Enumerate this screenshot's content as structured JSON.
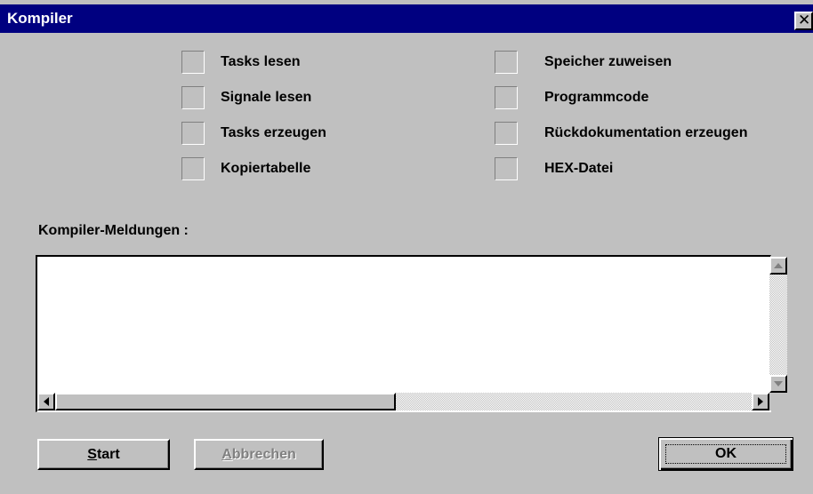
{
  "window": {
    "title": "Kompiler",
    "close_glyph": "✕"
  },
  "checklist": {
    "left": [
      {
        "label": "Tasks lesen"
      },
      {
        "label": "Signale lesen"
      },
      {
        "label": "Tasks erzeugen"
      },
      {
        "label": "Kopiertabelle"
      }
    ],
    "right": [
      {
        "label": "Speicher zuweisen"
      },
      {
        "label": "Programmcode"
      },
      {
        "label": "Rückdokumentation erzeugen"
      },
      {
        "label": "HEX-Datei"
      }
    ]
  },
  "messages": {
    "label": "Kompiler-Meldungen :",
    "content": ""
  },
  "buttons": {
    "start": {
      "accel": "S",
      "rest": "tart"
    },
    "abbrechen": {
      "accel": "A",
      "rest": "bbrechen"
    },
    "ok": "OK"
  },
  "icons": {
    "close": "close-icon",
    "scroll_up": "arrow-up-icon",
    "scroll_down": "arrow-down-icon",
    "scroll_left": "arrow-left-icon",
    "scroll_right": "arrow-right-icon"
  },
  "colors": {
    "titlebar": "#000080",
    "face": "#c0c0c0",
    "disabled_text": "#808080"
  }
}
